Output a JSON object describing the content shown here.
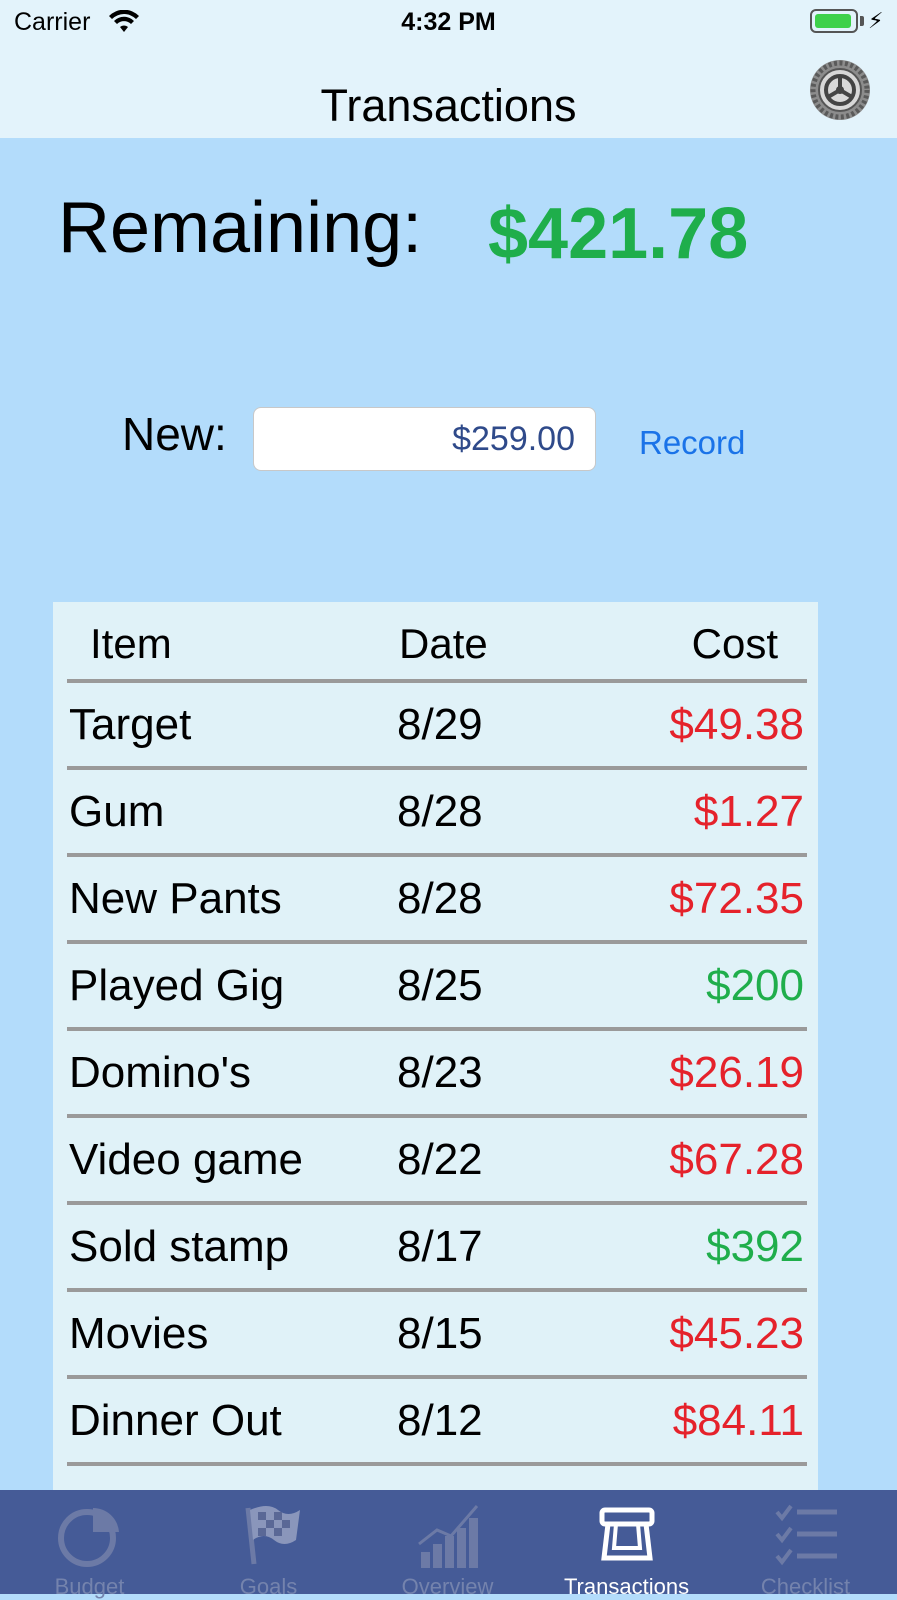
{
  "status_bar": {
    "carrier": "Carrier",
    "time": "4:32 PM",
    "battery_level": 0.9
  },
  "nav": {
    "title": "Transactions",
    "settings_icon": "gear-icon"
  },
  "summary": {
    "remaining_label": "Remaining:",
    "remaining_value": "$421.78"
  },
  "entry": {
    "new_label": "New:",
    "amount_value": "$259.00",
    "record_label": "Record"
  },
  "table": {
    "headers": {
      "item": "Item",
      "date": "Date",
      "cost": "Cost"
    },
    "rows": [
      {
        "item": "Target",
        "date": "8/29",
        "cost": "$49.38",
        "type": "expense"
      },
      {
        "item": "Gum",
        "date": "8/28",
        "cost": "$1.27",
        "type": "expense"
      },
      {
        "item": "New Pants",
        "date": "8/28",
        "cost": "$72.35",
        "type": "expense"
      },
      {
        "item": "Played Gig",
        "date": "8/25",
        "cost": "$200",
        "type": "income"
      },
      {
        "item": "Domino's",
        "date": "8/23",
        "cost": "$26.19",
        "type": "expense"
      },
      {
        "item": "Video game",
        "date": "8/22",
        "cost": "$67.28",
        "type": "expense"
      },
      {
        "item": "Sold stamp",
        "date": "8/17",
        "cost": "$392",
        "type": "income"
      },
      {
        "item": "Movies",
        "date": "8/15",
        "cost": "$45.23",
        "type": "expense"
      },
      {
        "item": "Dinner Out",
        "date": "8/12",
        "cost": "$84.11",
        "type": "expense"
      }
    ]
  },
  "colors": {
    "income": "#1fae4b",
    "expense": "#e5222b",
    "accent": "#1a73e8",
    "tabbar": "#455b97"
  },
  "tabs": [
    {
      "label": "Budget",
      "icon": "pie-chart-icon",
      "active": false
    },
    {
      "label": "Goals",
      "icon": "checkered-flag-icon",
      "active": false
    },
    {
      "label": "Overview",
      "icon": "bar-chart-icon",
      "active": false
    },
    {
      "label": "Transactions",
      "icon": "card-reader-icon",
      "active": true
    },
    {
      "label": "Checklist",
      "icon": "checklist-icon",
      "active": false
    }
  ]
}
